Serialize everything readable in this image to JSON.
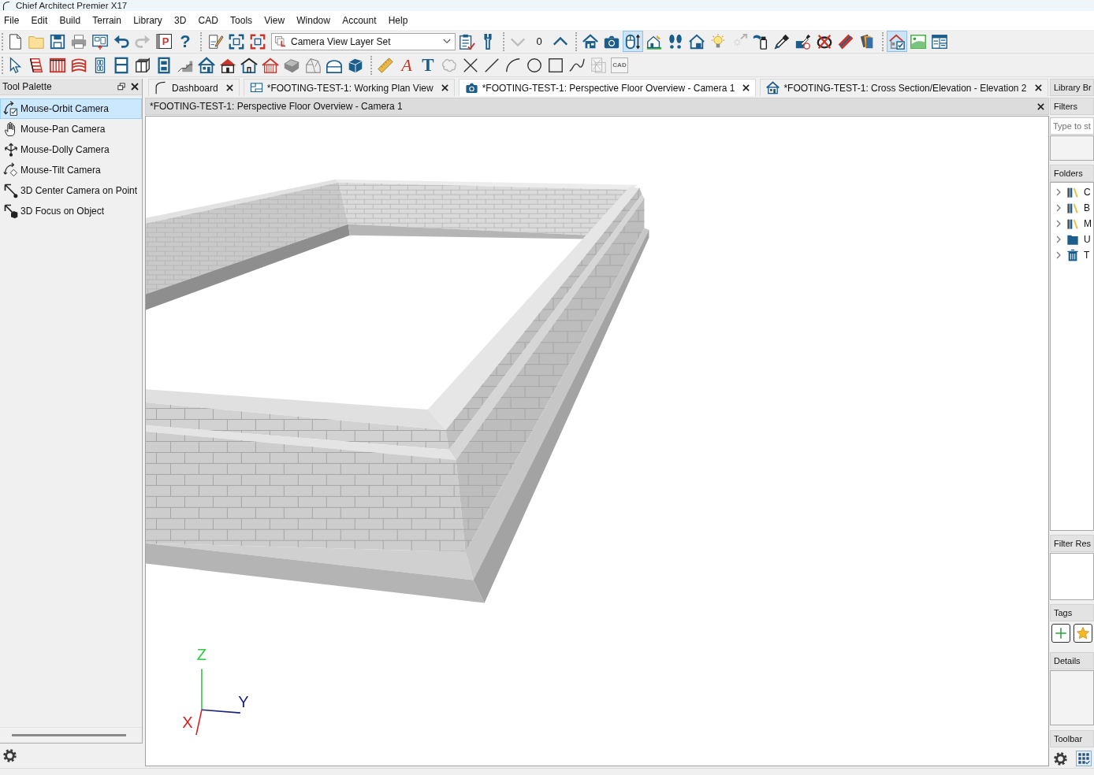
{
  "window": {
    "title": "Chief Architect Premier X17"
  },
  "menu": [
    "File",
    "Edit",
    "Build",
    "Terrain",
    "Library",
    "3D",
    "CAD",
    "Tools",
    "View",
    "Window",
    "Account",
    "Help"
  ],
  "toolbars": [
    {
      "items": [
        {
          "kind": "button",
          "selected": false,
          "disabled": false
        },
        {
          "kind": "button",
          "selected": false,
          "disabled": false
        },
        {
          "kind": "button",
          "selected": false,
          "disabled": false
        },
        {
          "kind": "button",
          "selected": false,
          "disabled": false
        },
        {
          "kind": "button",
          "selected": false,
          "disabled": false
        },
        {
          "kind": "button",
          "selected": false,
          "disabled": false
        },
        {
          "kind": "button",
          "selected": false,
          "disabled": true
        },
        {
          "kind": "button",
          "selected": false,
          "disabled": false,
          "glyph": "P"
        },
        {
          "kind": "button",
          "selected": false,
          "disabled": false,
          "glyph": "?"
        },
        {
          "kind": "separator"
        },
        {
          "kind": "button",
          "selected": false,
          "disabled": false
        },
        {
          "kind": "button",
          "selected": false,
          "disabled": false
        },
        {
          "kind": "button",
          "selected": false,
          "disabled": false
        },
        {
          "kind": "dropdown",
          "value": "Camera View Layer Set"
        },
        {
          "kind": "button",
          "selected": false,
          "disabled": false
        },
        {
          "kind": "button",
          "selected": false,
          "disabled": false
        },
        {
          "kind": "separator"
        },
        {
          "kind": "button",
          "selected": false,
          "disabled": true
        },
        {
          "kind": "counter",
          "value": "0"
        },
        {
          "kind": "button",
          "selected": false,
          "disabled": false
        },
        {
          "kind": "separator"
        },
        {
          "kind": "button",
          "selected": false,
          "disabled": false
        },
        {
          "kind": "button",
          "selected": false,
          "disabled": false
        },
        {
          "kind": "button",
          "selected": true,
          "disabled": false
        },
        {
          "kind": "button",
          "selected": false,
          "disabled": false
        },
        {
          "kind": "button",
          "selected": false,
          "disabled": false
        },
        {
          "kind": "button",
          "selected": false,
          "disabled": false
        },
        {
          "kind": "button",
          "selected": false,
          "disabled": false
        },
        {
          "kind": "button",
          "selected": false,
          "disabled": true
        },
        {
          "kind": "button",
          "selected": false,
          "disabled": false
        },
        {
          "kind": "button",
          "selected": false,
          "disabled": false
        },
        {
          "kind": "button",
          "selected": false,
          "disabled": false
        },
        {
          "kind": "button",
          "selected": false,
          "disabled": false
        },
        {
          "kind": "button",
          "selected": false,
          "disabled": false
        },
        {
          "kind": "button",
          "selected": false,
          "disabled": false
        },
        {
          "kind": "separator"
        },
        {
          "kind": "button",
          "selected": true,
          "disabled": false
        },
        {
          "kind": "button",
          "selected": false,
          "disabled": false
        },
        {
          "kind": "button",
          "selected": false,
          "disabled": false
        }
      ]
    },
    {
      "items": [
        {
          "kind": "button",
          "selected": false,
          "disabled": false
        },
        {
          "kind": "button",
          "selected": false,
          "disabled": false
        },
        {
          "kind": "button",
          "selected": false,
          "disabled": false
        },
        {
          "kind": "button",
          "selected": false,
          "disabled": false
        },
        {
          "kind": "button",
          "selected": false,
          "disabled": false
        },
        {
          "kind": "button",
          "selected": false,
          "disabled": false
        },
        {
          "kind": "button",
          "selected": false,
          "disabled": false
        },
        {
          "kind": "button",
          "selected": false,
          "disabled": false
        },
        {
          "kind": "button",
          "selected": false,
          "disabled": false
        },
        {
          "kind": "button",
          "selected": false,
          "disabled": false
        },
        {
          "kind": "button",
          "selected": false,
          "disabled": false
        },
        {
          "kind": "button",
          "selected": false,
          "disabled": false
        },
        {
          "kind": "button",
          "selected": false,
          "disabled": false
        },
        {
          "kind": "button",
          "selected": false,
          "disabled": false
        },
        {
          "kind": "button",
          "selected": false,
          "disabled": false
        },
        {
          "kind": "button",
          "selected": false,
          "disabled": false
        },
        {
          "kind": "button",
          "selected": false,
          "disabled": false
        },
        {
          "kind": "separator"
        },
        {
          "kind": "button",
          "selected": false,
          "disabled": false
        },
        {
          "kind": "button",
          "selected": false,
          "disabled": false,
          "glyph": "A"
        },
        {
          "kind": "button",
          "selected": false,
          "disabled": false,
          "glyph": "T"
        },
        {
          "kind": "button",
          "selected": false,
          "disabled": true
        },
        {
          "kind": "button",
          "selected": false,
          "disabled": false
        },
        {
          "kind": "button",
          "selected": false,
          "disabled": false
        },
        {
          "kind": "button",
          "selected": false,
          "disabled": false
        },
        {
          "kind": "button",
          "selected": false,
          "disabled": false
        },
        {
          "kind": "button",
          "selected": false,
          "disabled": false
        },
        {
          "kind": "button",
          "selected": false,
          "disabled": false
        },
        {
          "kind": "button",
          "selected": false,
          "disabled": true
        },
        {
          "kind": "button",
          "selected": false,
          "disabled": true,
          "glyph": "CAD"
        }
      ]
    }
  ],
  "tool_palette": {
    "title": "Tool Palette",
    "items": [
      {
        "label": "Mouse-Orbit Camera",
        "selected": true
      },
      {
        "label": "Mouse-Pan Camera",
        "selected": false
      },
      {
        "label": "Mouse-Dolly Camera",
        "selected": false
      },
      {
        "label": "Mouse-Tilt Camera",
        "selected": false
      },
      {
        "label": "3D Center Camera on Point",
        "selected": false
      },
      {
        "label": "3D Focus on Object",
        "selected": false
      }
    ]
  },
  "tabs": [
    {
      "label": "Dashboard",
      "selected": false
    },
    {
      "label": "*FOOTING-TEST-1: Working Plan View",
      "selected": false
    },
    {
      "label": "*FOOTING-TEST-1: Perspective Floor Overview - Camera 1",
      "selected": true
    },
    {
      "label": "*FOOTING-TEST-1: Cross Section/Elevation - Elevation 2",
      "selected": false
    }
  ],
  "view": {
    "title": "*FOOTING-TEST-1: Perspective Floor Overview - Camera 1",
    "axes": [
      {
        "label": "Z",
        "color": "#2ecc40"
      },
      {
        "label": "Y",
        "color": "#1a237e"
      },
      {
        "label": "X",
        "color": "#e01b1b"
      }
    ]
  },
  "library": {
    "title": "Library Br",
    "filters": {
      "title": "Filters",
      "search": {
        "placeholder": "Type to st"
      }
    },
    "folders": {
      "title": "Folders",
      "items": [
        {
          "label": "C",
          "expanded": false
        },
        {
          "label": "B",
          "expanded": false
        },
        {
          "label": "M",
          "expanded": false
        },
        {
          "label": "U",
          "expanded": false
        },
        {
          "label": "T",
          "expanded": false
        }
      ]
    },
    "filter_results": {
      "title": "Filter Res"
    },
    "tags": {
      "title": "Tags"
    },
    "details": {
      "title": "Details"
    },
    "toolbar": {
      "title": "Toolbar"
    }
  }
}
